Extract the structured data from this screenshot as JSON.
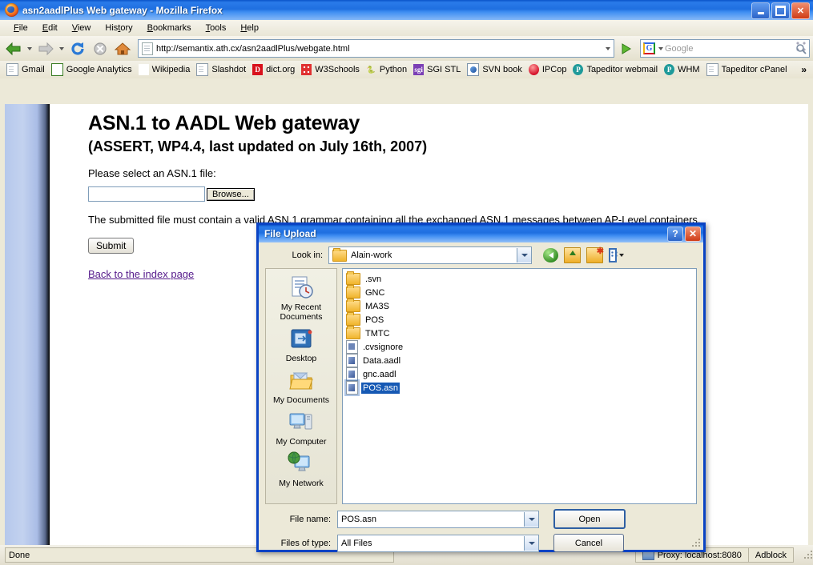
{
  "window": {
    "title": "asn2aadlPlus Web gateway - Mozilla Firefox",
    "logo_icon": "firefox-icon",
    "minimize_label": "Minimize",
    "maximize_label": "Maximize",
    "close_label": "Close"
  },
  "menubar": {
    "items": [
      {
        "label": "File"
      },
      {
        "label": "Edit"
      },
      {
        "label": "View"
      },
      {
        "label": "History"
      },
      {
        "label": "Bookmarks"
      },
      {
        "label": "Tools"
      },
      {
        "label": "Help"
      }
    ]
  },
  "navbar": {
    "back_icon": "back-arrow-icon",
    "forward_icon": "forward-arrow-icon",
    "reload_icon": "reload-icon",
    "stop_icon": "stop-icon",
    "home_icon": "home-icon",
    "url": "http://semantix.ath.cx/asn2aadlPlus/webgate.html",
    "url_dropdown_icon": "chevron-down-icon",
    "go_icon": "go-arrow-icon",
    "search_engine": "G",
    "search_placeholder": "Google",
    "search_value": "",
    "search_icon": "magnifier-icon"
  },
  "bookmarks": {
    "items": [
      {
        "label": "Gmail",
        "icon": "doc"
      },
      {
        "label": "Google Analytics",
        "icon": "ganal",
        "glyph": "G"
      },
      {
        "label": "Wikipedia",
        "icon": "wiki",
        "glyph": "W"
      },
      {
        "label": "Slashdot",
        "icon": "doc"
      },
      {
        "label": "dict.org",
        "icon": "dict",
        "glyph": "D"
      },
      {
        "label": "W3Schools",
        "icon": "w3s"
      },
      {
        "label": "Python",
        "icon": "py",
        "glyph": "🐍"
      },
      {
        "label": "SGI STL",
        "icon": "sgi",
        "glyph": "sgi"
      },
      {
        "label": "SVN book",
        "icon": "svn"
      },
      {
        "label": "IPCop",
        "icon": "ipcop"
      },
      {
        "label": "Tapeditor webmail",
        "icon": "cp",
        "glyph": "Ⓟ"
      },
      {
        "label": "WHM",
        "icon": "cp",
        "glyph": "Ⓟ"
      },
      {
        "label": "Tapeditor cPanel",
        "icon": "doc"
      }
    ],
    "overflow_label": "»"
  },
  "page": {
    "heading": "ASN.1 to AADL Web gateway",
    "subheading": "(ASSERT, WP4.4, last updated on July 16th, 2007)",
    "select_label": "Please select an ASN.1 file:",
    "file_input_value": "",
    "browse_label": "Browse...",
    "description": "The submitted file must contain a valid ASN.1 grammar containing all the exchanged ASN.1 messages between AP-Level containers.",
    "submit_label": "Submit",
    "back_link": "Back to the index page"
  },
  "statusbar": {
    "status": "Done",
    "proxy": "Proxy: localhost:8080",
    "adblock": "Adblock"
  },
  "dialog": {
    "title": "File Upload",
    "help_label": "?",
    "close_label": "✕",
    "lookin_label": "Look in:",
    "lookin_value": "Alain-work",
    "tools": [
      {
        "name": "back-icon",
        "title": "Back"
      },
      {
        "name": "up-one-level-icon",
        "title": "Up One Level"
      },
      {
        "name": "new-folder-icon",
        "title": "Create New Folder"
      },
      {
        "name": "views-icon",
        "title": "Views"
      }
    ],
    "places": [
      {
        "label": "My Recent Documents",
        "icon": "recent-documents-icon"
      },
      {
        "label": "Desktop",
        "icon": "desktop-icon"
      },
      {
        "label": "My Documents",
        "icon": "my-documents-icon"
      },
      {
        "label": "My Computer",
        "icon": "my-computer-icon"
      },
      {
        "label": "My Network",
        "icon": "my-network-icon"
      }
    ],
    "files": [
      {
        "name": ".svn",
        "type": "folder",
        "selected": false
      },
      {
        "name": "GNC",
        "type": "folder",
        "selected": false
      },
      {
        "name": "MA3S",
        "type": "folder",
        "selected": false
      },
      {
        "name": "POS",
        "type": "folder",
        "selected": false
      },
      {
        "name": "TMTC",
        "type": "folder",
        "selected": false
      },
      {
        "name": ".cvsignore",
        "type": "generic",
        "selected": false
      },
      {
        "name": "Data.aadl",
        "type": "aadl",
        "selected": false
      },
      {
        "name": "gnc.aadl",
        "type": "aadl",
        "selected": false
      },
      {
        "name": "POS.asn",
        "type": "aadl",
        "selected": true
      }
    ],
    "filename_label": "File name:",
    "filename_value": "POS.asn",
    "filetype_label": "Files of type:",
    "filetype_value": "All Files",
    "open_label": "Open",
    "cancel_label": "Cancel"
  },
  "colors": {
    "titlebar_blue": "#2a7bea",
    "selection_blue": "#1659b4",
    "chrome_beige": "#ece9d8",
    "link_purple": "#551a8b"
  }
}
